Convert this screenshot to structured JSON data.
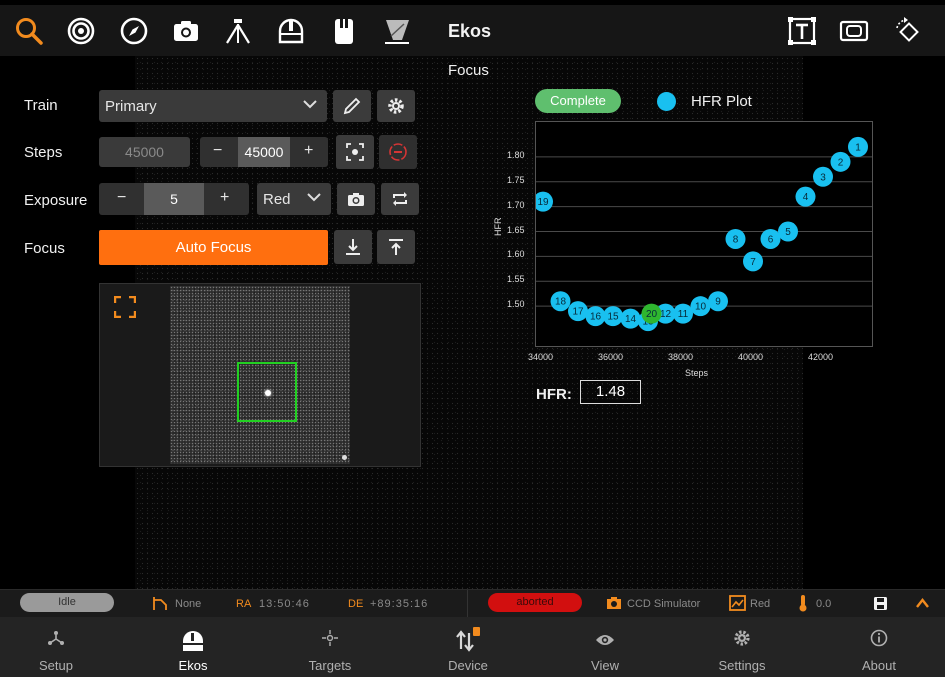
{
  "toolbar": {
    "title": "Ekos",
    "icons": [
      "search-icon",
      "target-icon",
      "compass-icon",
      "camera-icon",
      "tripod-icon",
      "dome-icon",
      "filter-icon",
      "flat-panel-icon",
      "text-overlay-icon",
      "capture-frame-icon",
      "rotate-icon"
    ],
    "accent": "#f28b1e"
  },
  "focus": {
    "title": "Focus",
    "train_label": "Train",
    "train_value": "Primary",
    "steps_label": "Steps",
    "steps_current": "45000",
    "steps_target": "45000",
    "exposure_label": "Exposure",
    "exposure_value": "5",
    "filter_value": "Red",
    "focus_label": "Focus",
    "auto_focus_label": "Auto Focus",
    "minus": "−",
    "plus": "+"
  },
  "hfr": {
    "label": "HFR:",
    "value": "1.48"
  },
  "chart_data": {
    "type": "scatter",
    "status_badge": "Complete",
    "legend": "HFR Plot",
    "xlabel": "Steps",
    "ylabel": "HFR",
    "xlim": [
      33800,
      43400
    ],
    "ylim": [
      1.42,
      1.87
    ],
    "x_ticks": [
      "34000",
      "36000",
      "38000",
      "40000",
      "42000"
    ],
    "x_tick_values": [
      34000,
      36000,
      38000,
      40000,
      42000
    ],
    "y_ticks": [
      "1.80",
      "1.75",
      "1.70",
      "1.65",
      "1.60",
      "1.55",
      "1.50"
    ],
    "y_tick_values": [
      1.8,
      1.75,
      1.7,
      1.65,
      1.6,
      1.55,
      1.5
    ],
    "points": [
      {
        "label": "1",
        "x": 43000,
        "y": 1.82
      },
      {
        "label": "2",
        "x": 42500,
        "y": 1.79
      },
      {
        "label": "3",
        "x": 42000,
        "y": 1.76
      },
      {
        "label": "4",
        "x": 41500,
        "y": 1.72
      },
      {
        "label": "5",
        "x": 41000,
        "y": 1.65
      },
      {
        "label": "6",
        "x": 40500,
        "y": 1.635
      },
      {
        "label": "7",
        "x": 40000,
        "y": 1.59
      },
      {
        "label": "8",
        "x": 39500,
        "y": 1.635
      },
      {
        "label": "9",
        "x": 39000,
        "y": 1.51
      },
      {
        "label": "10",
        "x": 38500,
        "y": 1.5
      },
      {
        "label": "11",
        "x": 38000,
        "y": 1.485
      },
      {
        "label": "12",
        "x": 37500,
        "y": 1.485
      },
      {
        "label": "13",
        "x": 37000,
        "y": 1.47
      },
      {
        "label": "14",
        "x": 36500,
        "y": 1.475
      },
      {
        "label": "15",
        "x": 36000,
        "y": 1.48
      },
      {
        "label": "16",
        "x": 35500,
        "y": 1.48
      },
      {
        "label": "17",
        "x": 35000,
        "y": 1.49
      },
      {
        "label": "18",
        "x": 34500,
        "y": 1.51
      },
      {
        "label": "19",
        "x": 34000,
        "y": 1.71
      },
      {
        "label": "20",
        "x": 37100,
        "y": 1.485,
        "highlight": true
      }
    ],
    "point_color": "#19c0f0",
    "highlight_color": "#2fb62f",
    "grid": true
  },
  "status": {
    "state": "Idle",
    "mount_target": "None",
    "ra_label": "RA",
    "ra_value": "13:50:46",
    "de_label": "DE",
    "de_value": "+89:35:16",
    "capture_state": "aborted",
    "camera": "CCD Simulator",
    "filter": "Red",
    "temperature": "0.0"
  },
  "nav": {
    "items": [
      {
        "label": "Setup",
        "icon": "setup-icon"
      },
      {
        "label": "Ekos",
        "icon": "ekos-icon",
        "active": true
      },
      {
        "label": "Targets",
        "icon": "targets-icon"
      },
      {
        "label": "Device",
        "icon": "device-icon"
      },
      {
        "label": "View",
        "icon": "eye-icon"
      },
      {
        "label": "Settings",
        "icon": "gear-icon"
      },
      {
        "label": "About",
        "icon": "info-icon"
      }
    ]
  }
}
